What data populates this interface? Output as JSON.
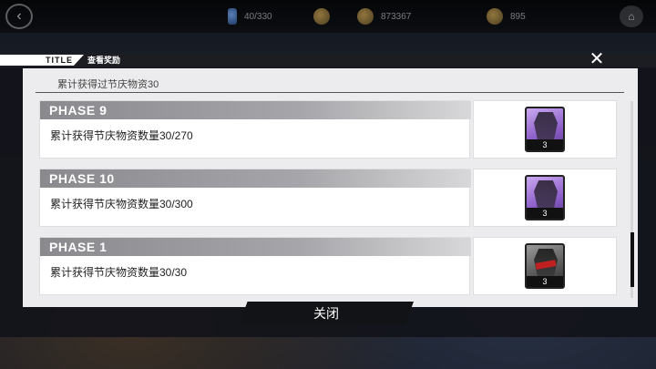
{
  "topbar": {
    "back_icon": "back-arrow-icon",
    "resources": [
      {
        "icon": "stamina-icon",
        "value": "40/330"
      },
      {
        "icon": "gold-coin-icon",
        "value": ""
      },
      {
        "icon": "coin-icon",
        "value": "873367"
      },
      {
        "icon": "crystal-icon",
        "value": "895"
      }
    ],
    "home_icon": "home-icon"
  },
  "dialog": {
    "title_label": "TITLE",
    "title": "查看奖励",
    "close_icon": "close-icon",
    "subtitle": "累计获得过节庆物资30",
    "rows": [
      {
        "phase": "PHASE 9",
        "desc": "累计获得节庆物资数量30/270",
        "reward_count": "3",
        "reward_style": "purple"
      },
      {
        "phase": "PHASE 10",
        "desc": "累计获得节庆物资数量30/300",
        "reward_count": "3",
        "reward_style": "purple"
      },
      {
        "phase": "PHASE 1",
        "desc": "累计获得节庆物资数量30/30",
        "reward_count": "3",
        "reward_style": "gray"
      }
    ],
    "close_button": "关闭"
  },
  "colors": {
    "panel_bg": "#ececee",
    "phase_header": "#8a8a8e",
    "dialog_bg": "#12141a",
    "button_bg": "#121316"
  }
}
